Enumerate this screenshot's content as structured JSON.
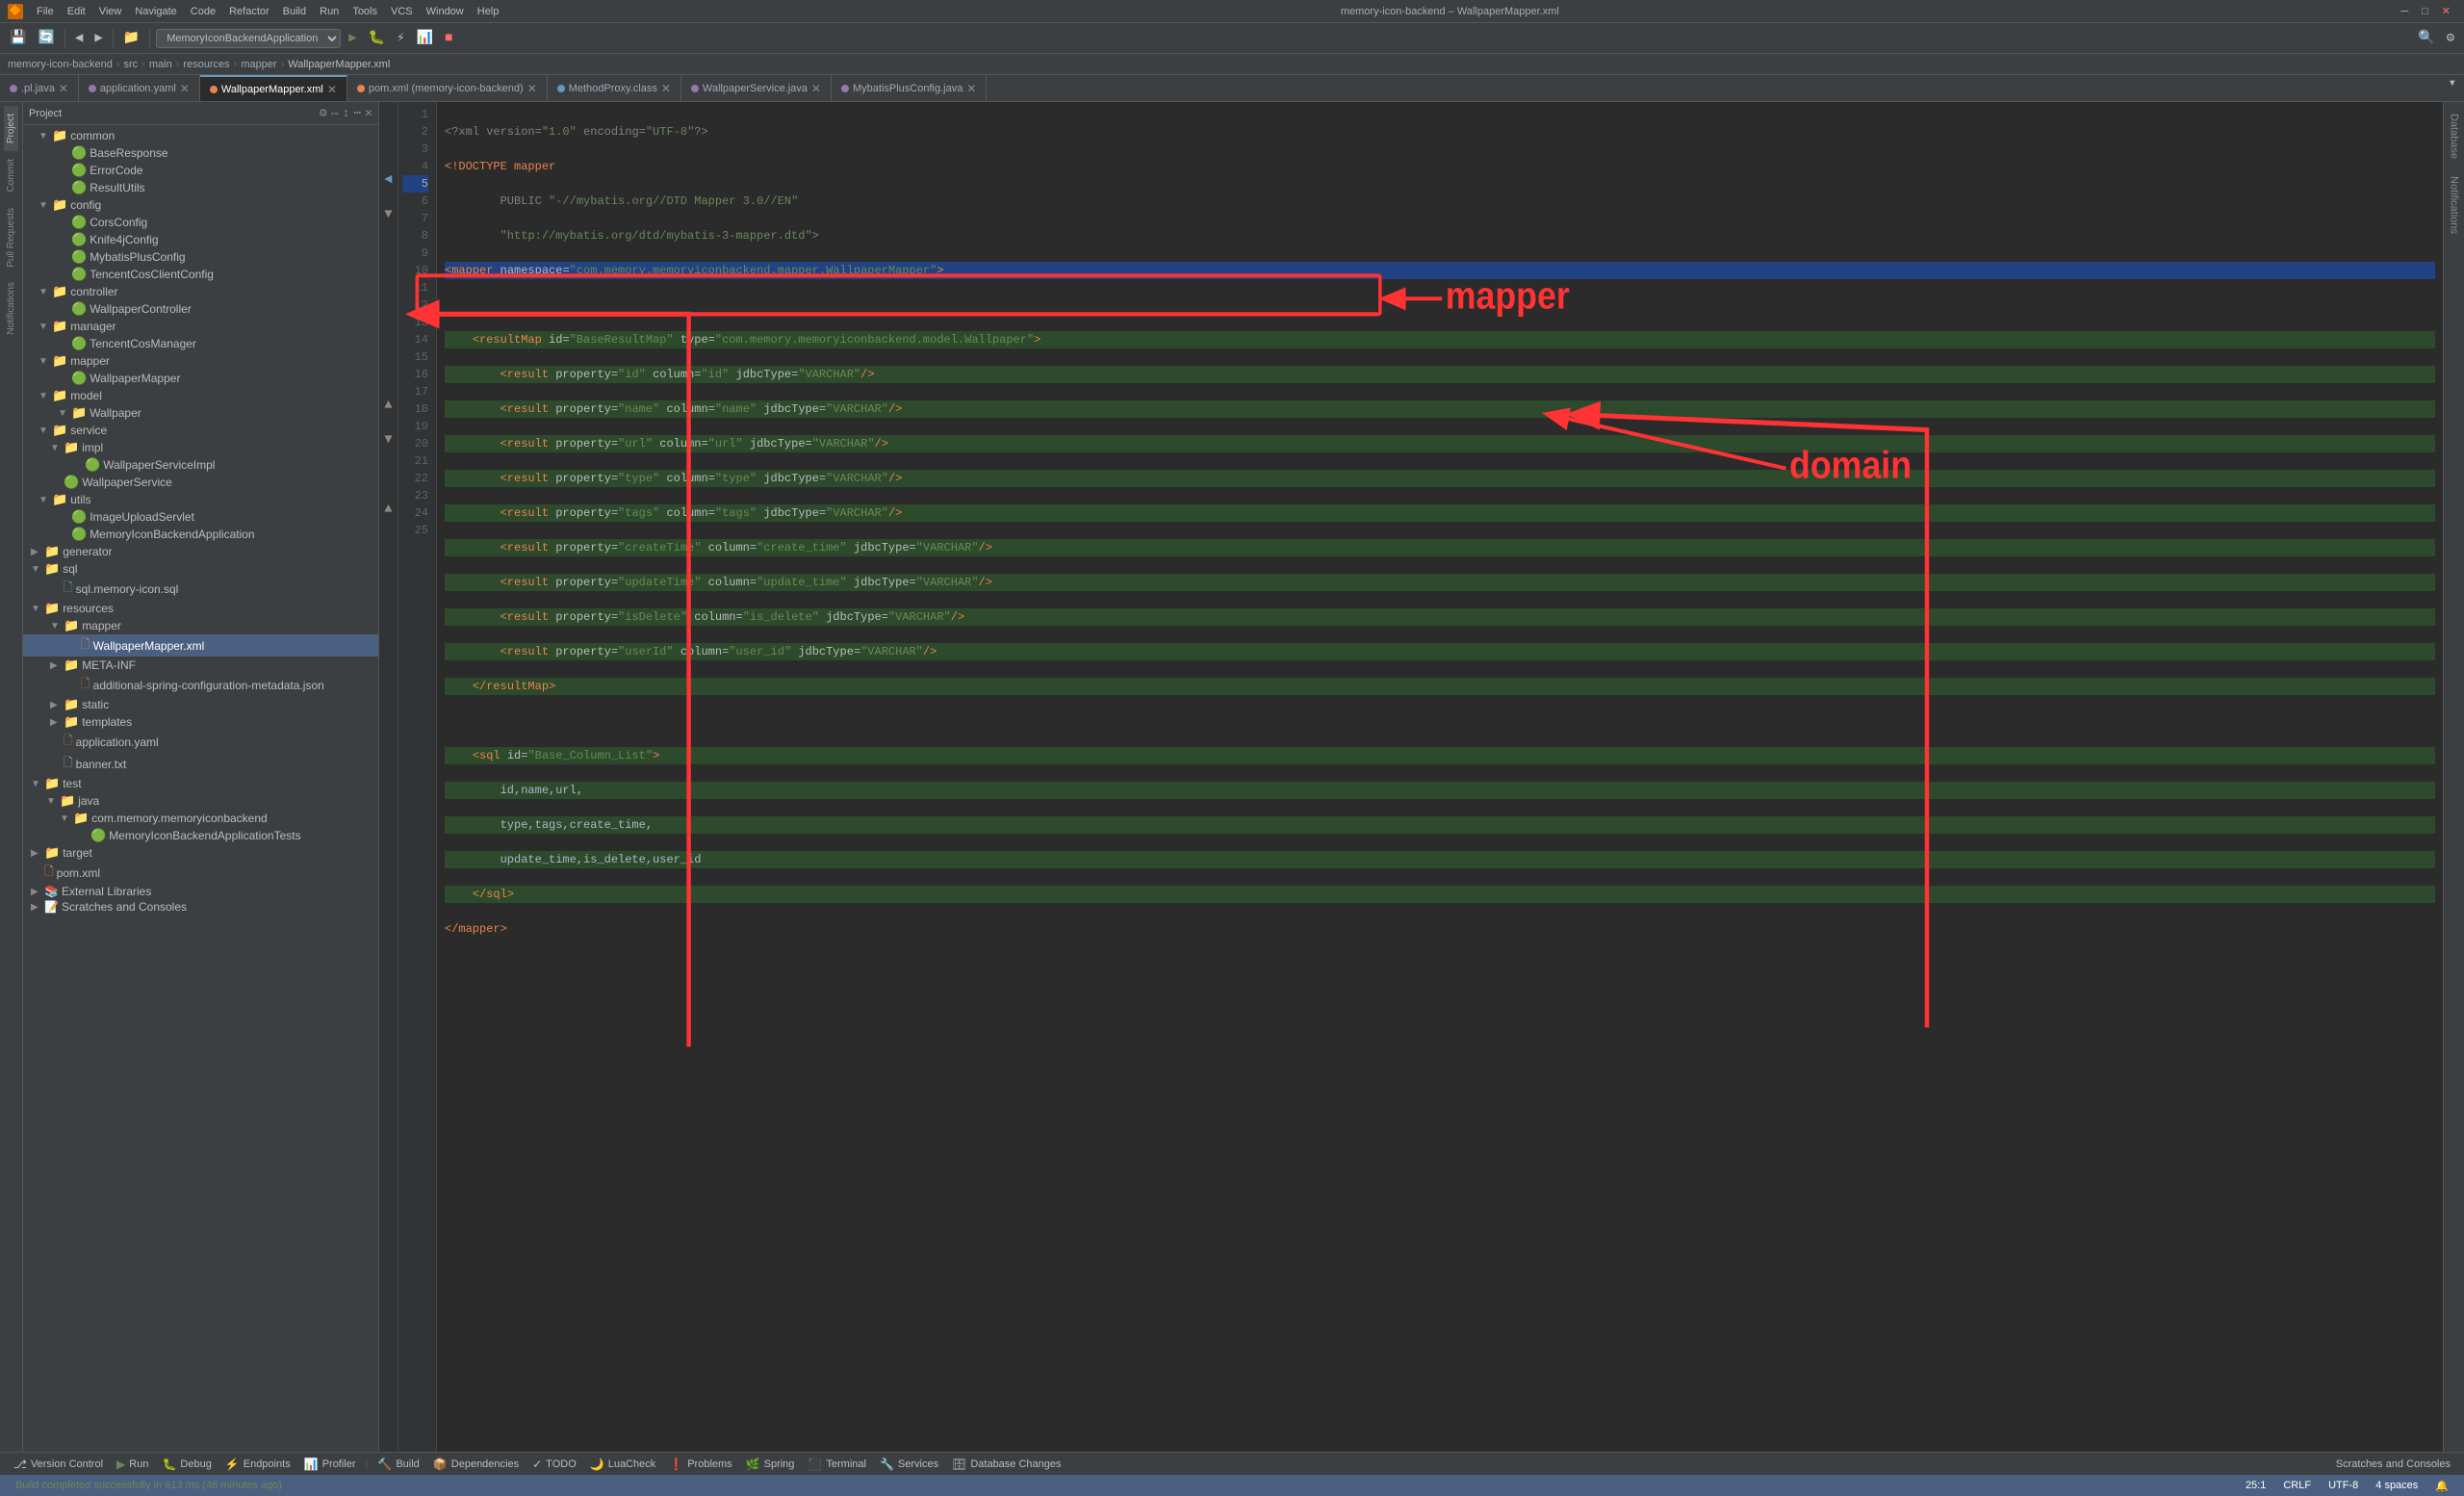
{
  "window_title": "memory-icon-backend – WallpaperMapper.xml",
  "menu": {
    "app_icon": "🔶",
    "items": [
      "File",
      "Edit",
      "View",
      "Navigate",
      "Code",
      "Refactor",
      "Build",
      "Run",
      "Tools",
      "VCS",
      "Window",
      "Help"
    ]
  },
  "toolbar": {
    "dropdown_label": "MemoryIconBackendApplication",
    "buttons": [
      "⬅",
      "➡",
      "🔄",
      "📁",
      "🔍",
      "▶",
      "⏸",
      "⏹"
    ]
  },
  "breadcrumb": {
    "items": [
      "memory-icon-backend",
      "src",
      "main",
      "resources",
      "mapper",
      "WallpaperMapper.xml"
    ]
  },
  "tabs": [
    {
      "name": ".pl.java",
      "type": "java",
      "active": false,
      "closable": true
    },
    {
      "name": "application.yaml",
      "type": "yaml",
      "active": false,
      "closable": true
    },
    {
      "name": "WallpaperMapper.xml",
      "type": "xml",
      "active": true,
      "closable": true
    },
    {
      "name": "pom.xml (memory-icon-backend)",
      "type": "xml",
      "active": false,
      "closable": true
    },
    {
      "name": "MethodProxy.class",
      "type": "class",
      "active": false,
      "closable": true
    },
    {
      "name": "WallpaperService.java",
      "type": "java",
      "active": false,
      "closable": true
    },
    {
      "name": "MybatisPlusConfig.java",
      "type": "java",
      "active": false,
      "closable": true
    }
  ],
  "sidebar": {
    "title": "Project",
    "tree": [
      {
        "indent": 1,
        "icon": "folder",
        "arrow": "▼",
        "label": "common"
      },
      {
        "indent": 2,
        "icon": "green",
        "label": "BaseResponse"
      },
      {
        "indent": 2,
        "icon": "green",
        "label": "ErrorCode"
      },
      {
        "indent": 2,
        "icon": "green",
        "label": "ResultUtils"
      },
      {
        "indent": 1,
        "icon": "folder",
        "arrow": "▼",
        "label": "config"
      },
      {
        "indent": 2,
        "icon": "green",
        "label": "CorsConfig"
      },
      {
        "indent": 2,
        "icon": "green",
        "label": "Knife4jConfig"
      },
      {
        "indent": 2,
        "icon": "green",
        "label": "MybatisPlusConfig"
      },
      {
        "indent": 2,
        "icon": "green",
        "label": "TencentCosClientConfig"
      },
      {
        "indent": 1,
        "icon": "folder",
        "arrow": "▼",
        "label": "controller"
      },
      {
        "indent": 2,
        "icon": "green",
        "label": "WallpaperController"
      },
      {
        "indent": 1,
        "icon": "folder",
        "arrow": "▼",
        "label": "manager"
      },
      {
        "indent": 2,
        "icon": "green",
        "label": "TencentCosManager"
      },
      {
        "indent": 1,
        "icon": "folder",
        "arrow": "▼",
        "label": "mapper"
      },
      {
        "indent": 2,
        "icon": "green",
        "label": "WallpaperMapper"
      },
      {
        "indent": 1,
        "icon": "folder",
        "arrow": "▼",
        "label": "model"
      },
      {
        "indent": 2,
        "icon": "folder",
        "arrow": "▼",
        "label": "Wallpaper"
      },
      {
        "indent": 1,
        "icon": "folder",
        "arrow": "▼",
        "label": "service"
      },
      {
        "indent": 2,
        "icon": "folder",
        "arrow": "▼",
        "label": "impl"
      },
      {
        "indent": 3,
        "icon": "green",
        "label": "WallpaperServiceImpl"
      },
      {
        "indent": 2,
        "icon": "green",
        "label": "WallpaperService"
      },
      {
        "indent": 1,
        "icon": "folder",
        "arrow": "▼",
        "label": "utils"
      },
      {
        "indent": 2,
        "icon": "green",
        "label": "ImageUploadServlet"
      },
      {
        "indent": 2,
        "icon": "green",
        "label": "MemoryIconBackendApplication"
      },
      {
        "indent": 0,
        "icon": "folder",
        "label": "generator"
      },
      {
        "indent": 0,
        "icon": "folder",
        "arrow": "▼",
        "label": "sql"
      },
      {
        "indent": 1,
        "icon": "sql",
        "label": "sql.memory-icon.sql"
      },
      {
        "indent": 0,
        "icon": "folder",
        "arrow": "▼",
        "label": "resources"
      },
      {
        "indent": 1,
        "icon": "folder",
        "arrow": "▼",
        "label": "mapper"
      },
      {
        "indent": 2,
        "icon": "xml",
        "label": "WallpaperMapper.xml",
        "selected": true
      },
      {
        "indent": 1,
        "icon": "folder",
        "label": "META-INF"
      },
      {
        "indent": 2,
        "icon": "yaml",
        "label": "additional-spring-configuration-metadata.json"
      },
      {
        "indent": 1,
        "icon": "folder",
        "label": "static"
      },
      {
        "indent": 1,
        "icon": "folder",
        "label": "templates"
      },
      {
        "indent": 1,
        "icon": "yaml",
        "label": "application.yaml"
      },
      {
        "indent": 1,
        "icon": "xml",
        "label": "banner.txt"
      },
      {
        "indent": 0,
        "icon": "folder",
        "arrow": "▼",
        "label": "test"
      },
      {
        "indent": 1,
        "icon": "folder",
        "arrow": "▼",
        "label": "java"
      },
      {
        "indent": 2,
        "icon": "folder",
        "arrow": "▼",
        "label": "com.memory.memoryiconbackend"
      },
      {
        "indent": 3,
        "icon": "green",
        "label": "MemoryIconBackendApplicationTests"
      },
      {
        "indent": 0,
        "icon": "folder",
        "label": "target"
      },
      {
        "indent": 0,
        "icon": "xml",
        "label": "pom.xml"
      },
      {
        "indent": 0,
        "icon": "folder",
        "label": "External Libraries"
      },
      {
        "indent": 0,
        "icon": "folder",
        "label": "Scratches and Consoles"
      }
    ]
  },
  "code": {
    "lines": [
      {
        "num": 1,
        "text": "<?xml version=\"1.0\" encoding=\"UTF-8\"?>"
      },
      {
        "num": 2,
        "text": "<!DOCTYPE mapper"
      },
      {
        "num": 3,
        "text": "        PUBLIC \"-//mybatis.org//DTD Mapper 3.0//EN\""
      },
      {
        "num": 4,
        "text": "        \"http://mybatis.org/dtd/mybatis-3-mapper.dtd\">"
      },
      {
        "num": 5,
        "text": "<mapper namespace=\"com.memory.memoryiconbackend.mapper.WallpaperMapper\">",
        "highlight": true
      },
      {
        "num": 6,
        "text": ""
      },
      {
        "num": 7,
        "text": "    <resultMap id=\"BaseResultMap\" type=\"com.memory.memoryiconbackend.model.Wallpaper\">",
        "section": true
      },
      {
        "num": 8,
        "text": "        <result property=\"id\" column=\"id\" jdbcType=\"VARCHAR\"/>",
        "section": true
      },
      {
        "num": 9,
        "text": "        <result property=\"name\" column=\"name\" jdbcType=\"VARCHAR\"/>",
        "section": true
      },
      {
        "num": 10,
        "text": "        <result property=\"url\" column=\"url\" jdbcType=\"VARCHAR\"/>",
        "section": true
      },
      {
        "num": 11,
        "text": "        <result property=\"type\" column=\"type\" jdbcType=\"VARCHAR\"/>",
        "section": true
      },
      {
        "num": 12,
        "text": "        <result property=\"tags\" column=\"tags\" jdbcType=\"VARCHAR\"/>",
        "section": true
      },
      {
        "num": 13,
        "text": "        <result property=\"createTime\" column=\"create_time\" jdbcType=\"VARCHAR\"/>",
        "section": true
      },
      {
        "num": 14,
        "text": "        <result property=\"updateTime\" column=\"update_time\" jdbcType=\"VARCHAR\"/>",
        "section": true
      },
      {
        "num": 15,
        "text": "        <result property=\"isDelete\" column=\"is_delete\" jdbcType=\"VARCHAR\"/>",
        "section": true
      },
      {
        "num": 16,
        "text": "        <result property=\"userId\" column=\"user_id\" jdbcType=\"VARCHAR\"/>",
        "section": true
      },
      {
        "num": 17,
        "text": "    </resultMap>",
        "section": true
      },
      {
        "num": 18,
        "text": ""
      },
      {
        "num": 19,
        "text": "    <sql id=\"Base_Column_List\">",
        "section2": true
      },
      {
        "num": 20,
        "text": "        id,name,url,",
        "section2": true
      },
      {
        "num": 21,
        "text": "        type,tags,create_time,",
        "section2": true
      },
      {
        "num": 22,
        "text": "        update_time,is_delete,user_id",
        "section2": true
      },
      {
        "num": 23,
        "text": "    </sql>",
        "section2": true
      },
      {
        "num": 24,
        "text": "</mapper>"
      },
      {
        "num": 25,
        "text": ""
      }
    ]
  },
  "annotations": {
    "mapper_label": "mapper",
    "domain_label": "domain"
  },
  "bottom_tools": [
    {
      "icon": "⎇",
      "label": "Version Control"
    },
    {
      "icon": "▶",
      "label": "Run"
    },
    {
      "icon": "🐛",
      "label": "Debug"
    },
    {
      "icon": "⚡",
      "label": "Endpoints"
    },
    {
      "icon": "📊",
      "label": "Profiler"
    },
    {
      "icon": "🔨",
      "label": "Build"
    },
    {
      "icon": "📦",
      "label": "Dependencies"
    },
    {
      "icon": "✓",
      "label": "TODO"
    },
    {
      "icon": "🌙",
      "label": "LuaCheck"
    },
    {
      "icon": "❗",
      "label": "Problems"
    },
    {
      "icon": "🌿",
      "label": "Spring"
    },
    {
      "icon": "⬛",
      "label": "Terminal"
    },
    {
      "icon": "🔧",
      "label": "Services"
    },
    {
      "icon": "🗄",
      "label": "Database Changes"
    }
  ],
  "status_bar": {
    "message": "Build completed successfully in 613 ms (46 minutes ago)",
    "position": "25:1",
    "encoding": "CRLF",
    "charset": "UTF-8",
    "indent": "4 spaces"
  }
}
